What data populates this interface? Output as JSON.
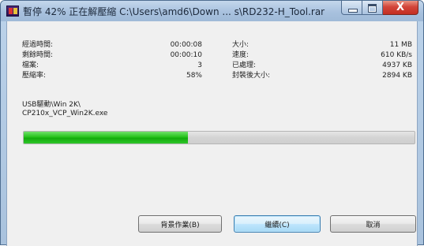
{
  "window": {
    "title": "暫停 42% 正在解壓縮 C:\\Users\\amd6\\Down ... s\\RD232-H_Tool.rar",
    "controls": {
      "minimize": "minimize",
      "maximize": "maximize",
      "close": "X"
    }
  },
  "stats": {
    "elapsed_label": "經過時間:",
    "elapsed_value": "00:00:08",
    "remaining_label": "剩餘時間:",
    "remaining_value": "00:00:10",
    "files_label": "檔案:",
    "files_value": "3",
    "ratio_label": "壓縮率:",
    "ratio_value": "58%",
    "size_label": "大小:",
    "size_value": "11 MB",
    "speed_label": "速度:",
    "speed_value": "610 KB/s",
    "processed_label": "已處理:",
    "processed_value": "4937 KB",
    "packed_size_label": "封裝後大小:",
    "packed_size_value": "2894 KB"
  },
  "current_file": {
    "folder": "USB驅動\\Win 2K\\",
    "name": "CP210x_VCP_Win2K.exe"
  },
  "progress": {
    "fraction": 0.42,
    "color": "#26c21c"
  },
  "buttons": {
    "background": "背景作業(B)",
    "continue": "繼續(C)",
    "cancel": "取消"
  }
}
